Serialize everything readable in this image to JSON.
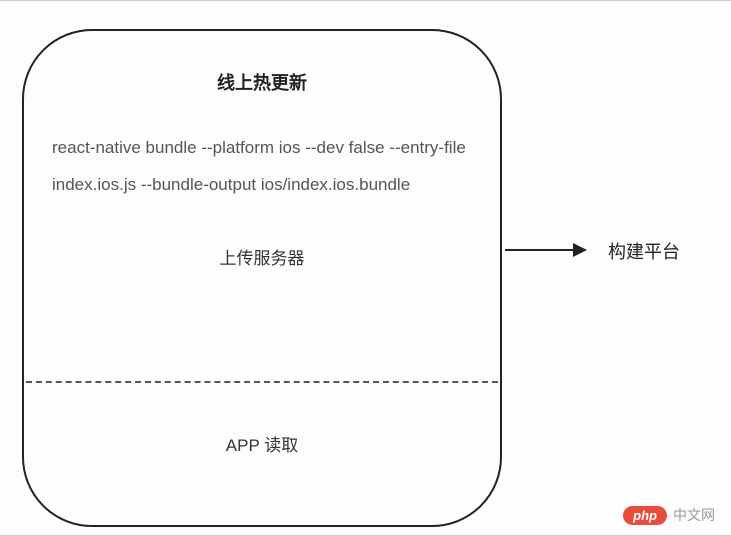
{
  "box": {
    "title": "线上热更新",
    "command": "react-native bundle --platform ios --dev false --entry-file index.ios.js --bundle-output ios/index.ios.bundle",
    "upload_label": "上传服务器",
    "app_read_label": "APP 读取"
  },
  "arrow_target_label": "构建平台",
  "watermark": {
    "pill": "php",
    "text": "中文网"
  }
}
